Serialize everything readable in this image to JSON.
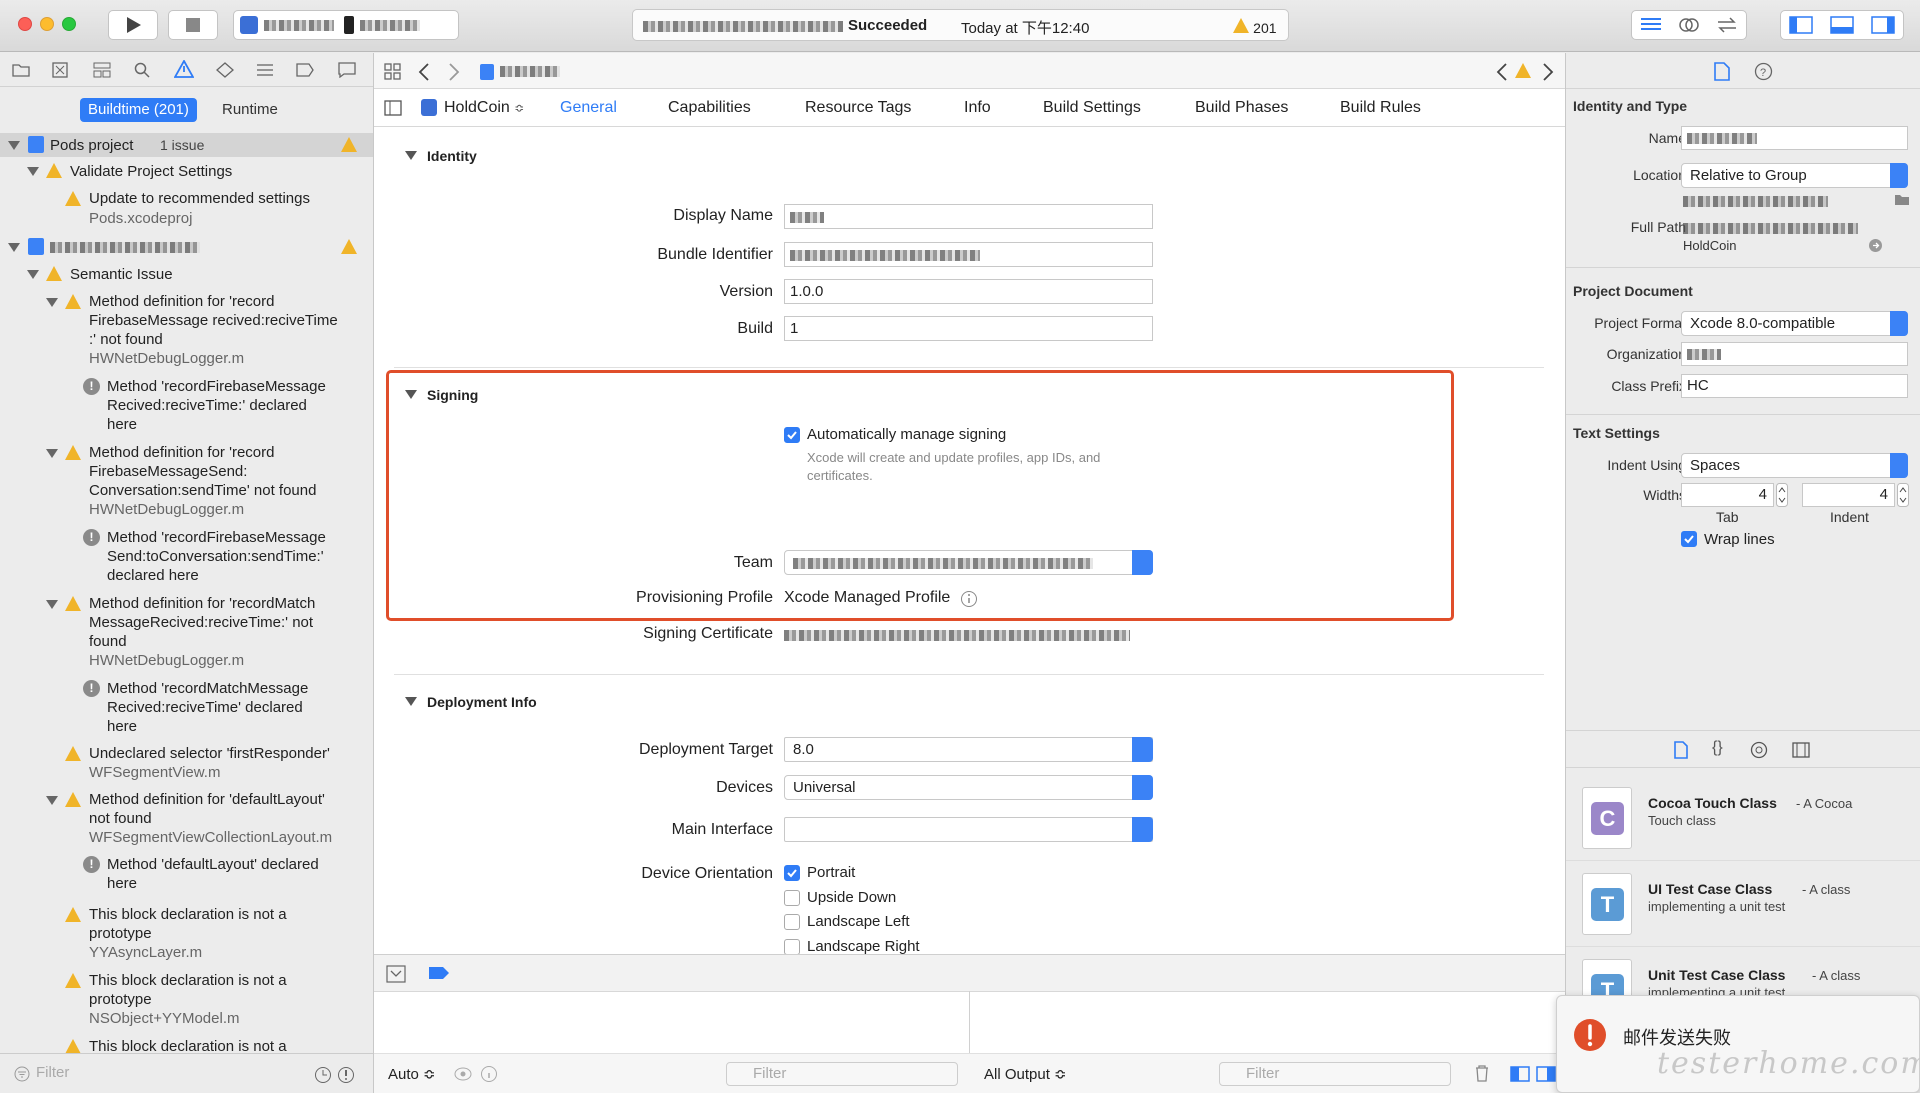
{
  "toolbar": {
    "status_main": "Succeeded",
    "status_time": "Today at 下午12:40",
    "warning_count": "201"
  },
  "navigator": {
    "seg_buildtime": "Buildtime (201)",
    "seg_runtime": "Runtime",
    "filter_placeholder": "Filter",
    "items": [
      {
        "title": "Pods project",
        "sub": "1 issue"
      },
      {
        "title": "Validate Project Settings"
      },
      {
        "title": "Update to recommended settings",
        "sub": "Pods.xcodeproj"
      },
      {
        "title": "Semantic Issue"
      },
      {
        "line1": "Method definition for 'record",
        "line2": "FirebaseMessage recived:reciveTime",
        "line3": ":' not found",
        "file": "HWNetDebugLogger.m"
      },
      {
        "line1": "Method 'recordFirebaseMessage",
        "line2": "Recived:reciveTime:' declared",
        "line3": "here"
      },
      {
        "line1": "Method definition for 'record",
        "line2": "FirebaseMessageSend:",
        "line3": "Conversation:sendTime' not found",
        "file": "HWNetDebugLogger.m"
      },
      {
        "line1": "Method 'recordFirebaseMessage",
        "line2": "Send:toConversation:sendTime:'",
        "line3": "declared here"
      },
      {
        "line1": "Method definition for 'recordMatch",
        "line2": "MessageRecived:reciveTime:' not",
        "line3": "found",
        "file": "HWNetDebugLogger.m"
      },
      {
        "line1": "Method 'recordMatchMessage",
        "line2": "Recived:reciveTime' declared",
        "line3": "here"
      },
      {
        "line1": "Undeclared selector 'firstResponder'",
        "file": "WFSegmentView.m"
      },
      {
        "line1": "Method definition for 'defaultLayout'",
        "line2": "not found",
        "file": "WFSegmentViewCollectionLayout.m"
      },
      {
        "line1": "Method 'defaultLayout' declared",
        "line2": "here"
      },
      {
        "line1": "This block declaration is not a",
        "line2": "prototype",
        "file": "YYAsyncLayer.m"
      },
      {
        "line1": "This block declaration is not a",
        "line2": "prototype",
        "file": "NSObject+YYModel.m"
      },
      {
        "line1": "This block declaration is not a"
      }
    ]
  },
  "editor": {
    "target": "HoldCoin",
    "tabs": [
      "General",
      "Capabilities",
      "Resource Tags",
      "Info",
      "Build Settings",
      "Build Phases",
      "Build Rules"
    ],
    "identity": {
      "heading": "Identity",
      "display_name_label": "Display Name",
      "bundle_id_label": "Bundle Identifier",
      "version_label": "Version",
      "version": "1.0.0",
      "build_label": "Build",
      "build": "1"
    },
    "signing": {
      "heading": "Signing",
      "auto_label": "Automatically manage signing",
      "auto_note": "Xcode will create and update profiles, app IDs, and certificates.",
      "team_label": "Team",
      "profile_label": "Provisioning Profile",
      "profile": "Xcode Managed Profile",
      "cert_label": "Signing Certificate"
    },
    "deployment": {
      "heading": "Deployment Info",
      "target_label": "Deployment Target",
      "target": "8.0",
      "devices_label": "Devices",
      "devices": "Universal",
      "interface_label": "Main Interface",
      "orientation_label": "Device Orientation",
      "orientations": [
        "Portrait",
        "Upside Down",
        "Landscape Left",
        "Landscape Right"
      ]
    },
    "debug": {
      "auto_label": "Auto ≎",
      "filter_placeholder": "Filter",
      "output_label": "All Output ≎",
      "filter2_placeholder": "Filter"
    }
  },
  "inspector": {
    "identity_heading": "Identity and Type",
    "name_label": "Name",
    "location_label": "Location",
    "location": "Relative to Group",
    "full_path_label": "Full Path",
    "full_path_tail": "HoldCoin",
    "project_doc_heading": "Project Document",
    "format_label": "Project Format",
    "format": "Xcode 8.0-compatible",
    "org_label": "Organization",
    "prefix_label": "Class Prefix",
    "prefix": "HC",
    "text_heading": "Text Settings",
    "indent_label": "Indent Using",
    "indent": "Spaces",
    "widths_label": "Widths",
    "tab_value": "4",
    "indent_value": "4",
    "tab_caption": "Tab",
    "indent_caption": "Indent",
    "wrap_label": "Wrap lines",
    "library": [
      {
        "title": "Cocoa Touch Class",
        "desc1": " - A Cocoa",
        "desc2": "Touch class",
        "letter": "C",
        "color": "#9b87c9"
      },
      {
        "title": "UI Test Case Class",
        "desc1": " - A class",
        "desc2": "implementing a unit test",
        "letter": "T",
        "color": "#5b9bd5"
      },
      {
        "title": "Unit Test Case Class",
        "desc1": " - A class",
        "desc2": "implementing a unit test",
        "letter": "T",
        "color": "#5b9bd5"
      }
    ],
    "toast": "邮件发送失败",
    "watermark": "testerhome.com"
  },
  "colors": {
    "accent": "#2f7cf6",
    "warning": "#f0b429",
    "signing_box": "#e04e2a"
  }
}
